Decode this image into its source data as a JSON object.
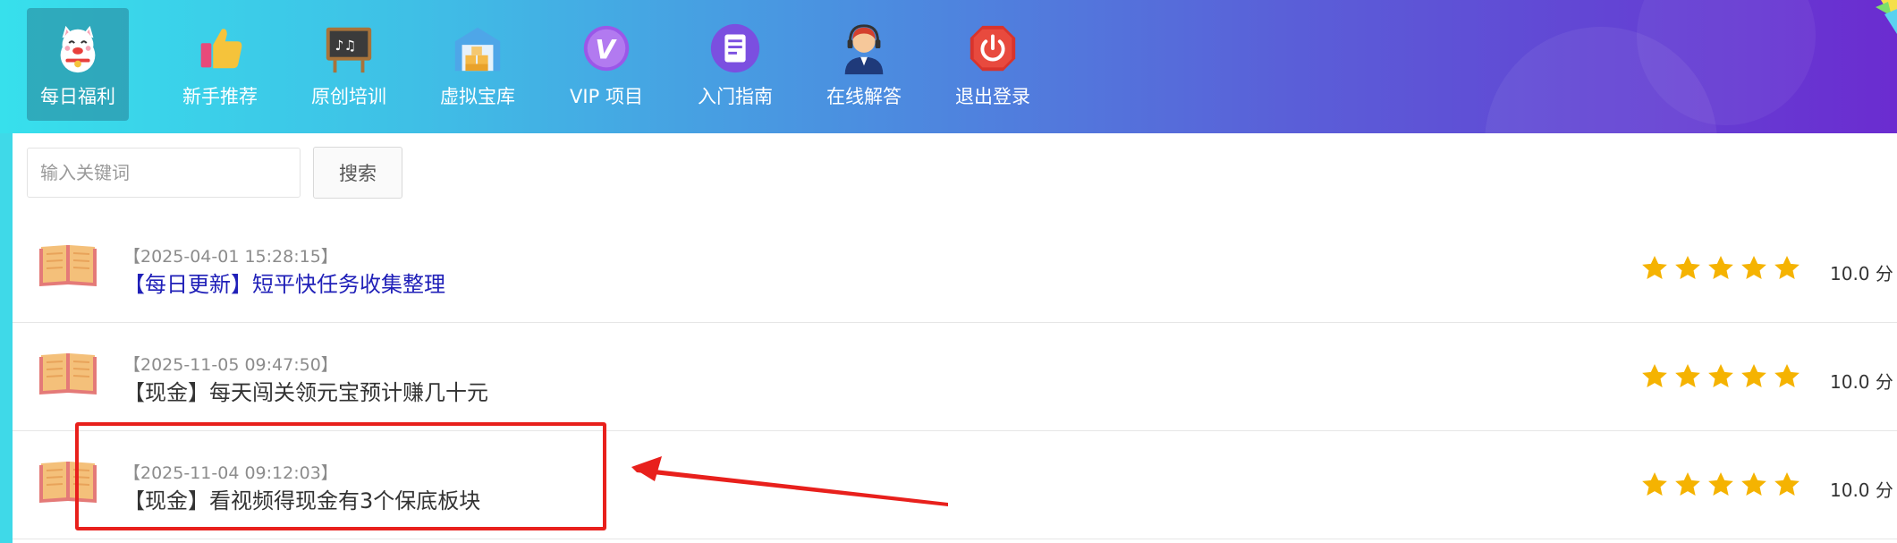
{
  "nav": {
    "items": [
      {
        "label": "每日福利",
        "icon": "lucky-cat-icon",
        "active": true
      },
      {
        "label": "新手推荐",
        "icon": "thumbs-up-icon",
        "active": false
      },
      {
        "label": "原创培训",
        "icon": "chalkboard-icon",
        "active": false
      },
      {
        "label": "虚拟宝库",
        "icon": "warehouse-icon",
        "active": false
      },
      {
        "label": "VIP 项目",
        "icon": "vip-icon",
        "active": false
      },
      {
        "label": "入门指南",
        "icon": "guide-doc-icon",
        "active": false
      },
      {
        "label": "在线解答",
        "icon": "support-agent-icon",
        "active": false
      },
      {
        "label": "退出登录",
        "icon": "power-icon",
        "active": false
      }
    ]
  },
  "search": {
    "placeholder": "输入关键词",
    "button_label": "搜索"
  },
  "list": {
    "items": [
      {
        "date": "【2025-04-01 15:28:15】",
        "title": "【每日更新】短平快任务收集整理",
        "rating_stars": 5,
        "score": "10.0 分"
      },
      {
        "date": "【2025-11-05 09:47:50】",
        "title": "【现金】每天闯关领元宝预计赚几十元",
        "rating_stars": 5,
        "score": "10.0 分"
      },
      {
        "date": "【2025-11-04 09:12:03】",
        "title": "【现金】看视频得现金有3个保底板块",
        "rating_stars": 5,
        "score": "10.0 分"
      }
    ]
  },
  "colors": {
    "header_gradient_start": "#37e0ec",
    "header_gradient_end": "#6b2cd0",
    "link_blue": "#2020b8",
    "star_gold": "#f5b301",
    "annotation_red": "#e8201c"
  }
}
